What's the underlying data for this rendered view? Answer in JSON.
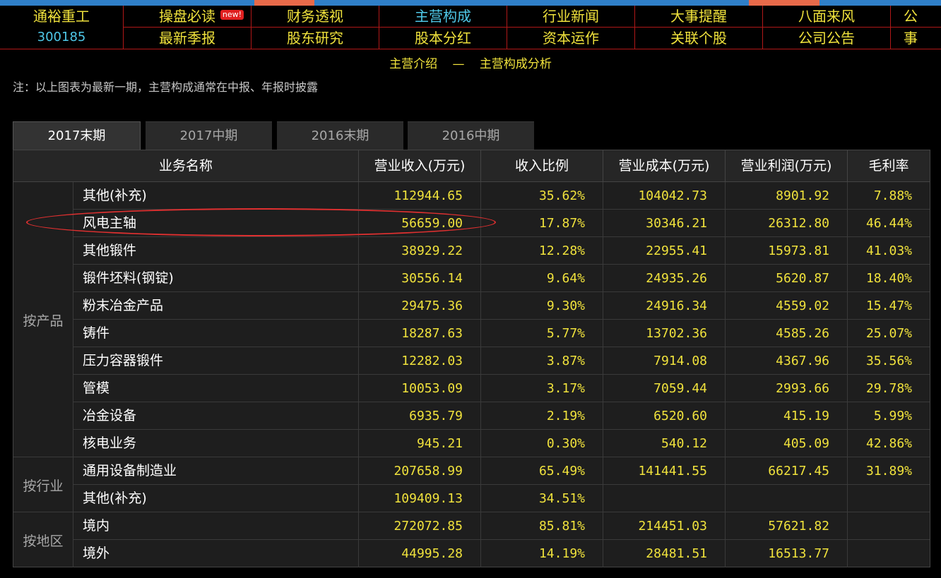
{
  "stock": {
    "name": "通裕重工",
    "code": "300185"
  },
  "nav": {
    "row1": [
      {
        "label": "操盘必读",
        "badge": "new!"
      },
      {
        "label": "财务透视"
      },
      {
        "label": "主营构成",
        "active": true
      },
      {
        "label": "行业新闻"
      },
      {
        "label": "大事提醒"
      },
      {
        "label": "八面来风"
      },
      {
        "label": "公"
      }
    ],
    "row2": [
      {
        "label": "最新季报"
      },
      {
        "label": "股东研究"
      },
      {
        "label": "股本分红"
      },
      {
        "label": "资本运作"
      },
      {
        "label": "关联个股"
      },
      {
        "label": "公司公告"
      },
      {
        "label": "事"
      }
    ]
  },
  "subtitle": {
    "left": "主营介绍",
    "sep": "—",
    "right": "主营构成分析"
  },
  "note": "注：以上图表为最新一期，主营构成通常在中报、年报时披露",
  "tabs": [
    "2017末期",
    "2017中期",
    "2016末期",
    "2016中期"
  ],
  "table": {
    "headers": [
      "业务名称",
      "营业收入(万元)",
      "收入比例",
      "营业成本(万元)",
      "营业利润(万元)",
      "毛利率"
    ],
    "groups": [
      {
        "label": "按产品",
        "rows": [
          [
            "其他(补充)",
            "112944.65",
            "35.62%",
            "104042.73",
            "8901.92",
            "7.88%"
          ],
          [
            "风电主轴",
            "56659.00",
            "17.87%",
            "30346.21",
            "26312.80",
            "46.44%"
          ],
          [
            "其他锻件",
            "38929.22",
            "12.28%",
            "22955.41",
            "15973.81",
            "41.03%"
          ],
          [
            "锻件坯料(钢锭)",
            "30556.14",
            "9.64%",
            "24935.26",
            "5620.87",
            "18.40%"
          ],
          [
            "粉末冶金产品",
            "29475.36",
            "9.30%",
            "24916.34",
            "4559.02",
            "15.47%"
          ],
          [
            "铸件",
            "18287.63",
            "5.77%",
            "13702.36",
            "4585.26",
            "25.07%"
          ],
          [
            "压力容器锻件",
            "12282.03",
            "3.87%",
            "7914.08",
            "4367.96",
            "35.56%"
          ],
          [
            "管模",
            "10053.09",
            "3.17%",
            "7059.44",
            "2993.66",
            "29.78%"
          ],
          [
            "冶金设备",
            "6935.79",
            "2.19%",
            "6520.60",
            "415.19",
            "5.99%"
          ],
          [
            "核电业务",
            "945.21",
            "0.30%",
            "540.12",
            "405.09",
            "42.86%"
          ]
        ]
      },
      {
        "label": "按行业",
        "rows": [
          [
            "通用设备制造业",
            "207658.99",
            "65.49%",
            "141441.55",
            "66217.45",
            "31.89%"
          ],
          [
            "其他(补充)",
            "109409.13",
            "34.51%",
            "",
            "",
            ""
          ]
        ]
      },
      {
        "label": "按地区",
        "rows": [
          [
            "境内",
            "272072.85",
            "85.81%",
            "214451.03",
            "57621.82",
            ""
          ],
          [
            "境外",
            "44995.28",
            "14.19%",
            "28481.51",
            "16513.77",
            ""
          ]
        ]
      }
    ]
  },
  "colors": {
    "accent_yellow": "#f0e23c",
    "accent_cyan": "#4fc8e8",
    "border_red": "#b01818",
    "highlight_red": "#e03030"
  }
}
